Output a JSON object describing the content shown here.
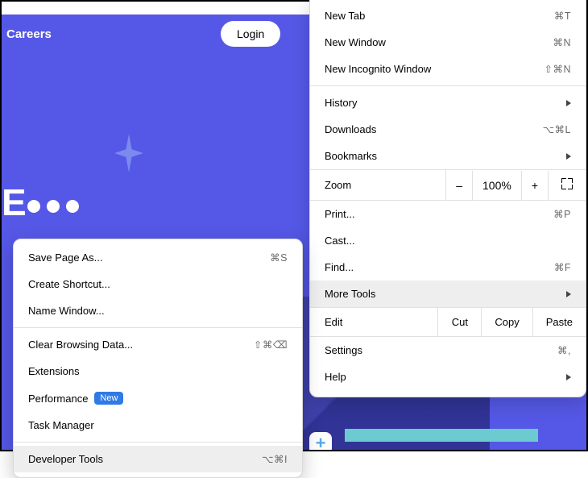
{
  "page": {
    "nav_careers": "Careers",
    "login": "Login",
    "hero_fragment": "E",
    "plus": "+"
  },
  "menu": {
    "new_tab": {
      "label": "New Tab",
      "shortcut": "⌘T"
    },
    "new_window": {
      "label": "New Window",
      "shortcut": "⌘N"
    },
    "new_incognito": {
      "label": "New Incognito Window",
      "shortcut": "⇧⌘N"
    },
    "history": {
      "label": "History"
    },
    "downloads": {
      "label": "Downloads",
      "shortcut": "⌥⌘L"
    },
    "bookmarks": {
      "label": "Bookmarks"
    },
    "zoom": {
      "label": "Zoom",
      "minus": "–",
      "value": "100%",
      "plus": "+"
    },
    "print": {
      "label": "Print...",
      "shortcut": "⌘P"
    },
    "cast": {
      "label": "Cast..."
    },
    "find": {
      "label": "Find...",
      "shortcut": "⌘F"
    },
    "more_tools": {
      "label": "More Tools"
    },
    "edit": {
      "label": "Edit",
      "cut": "Cut",
      "copy": "Copy",
      "paste": "Paste"
    },
    "settings": {
      "label": "Settings",
      "shortcut": "⌘,"
    },
    "help": {
      "label": "Help"
    }
  },
  "submenu": {
    "save_page": {
      "label": "Save Page As...",
      "shortcut": "⌘S"
    },
    "create_shortcut": {
      "label": "Create Shortcut..."
    },
    "name_window": {
      "label": "Name Window..."
    },
    "clear_browsing": {
      "label": "Clear Browsing Data...",
      "shortcut": "⇧⌘⌫"
    },
    "extensions": {
      "label": "Extensions"
    },
    "performance": {
      "label": "Performance",
      "badge": "New"
    },
    "task_manager": {
      "label": "Task Manager"
    },
    "developer_tools": {
      "label": "Developer Tools",
      "shortcut": "⌥⌘I"
    }
  }
}
